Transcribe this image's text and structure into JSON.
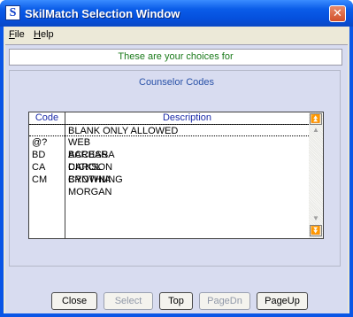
{
  "window": {
    "title": "SkilMatch Selection Window",
    "app_icon_glyph": "S",
    "close_glyph": "✕"
  },
  "menu": [
    {
      "label": "File",
      "underline": "F",
      "rest": "ile"
    },
    {
      "label": "Help",
      "underline": "H",
      "rest": "elp"
    }
  ],
  "banner": "These are your choices for",
  "subtitle": "Counselor Codes",
  "table": {
    "columns": [
      "Code",
      "Description"
    ],
    "rows": [
      {
        "code": "",
        "description": "BLANK ONLY ALLOWED",
        "selected": true
      },
      {
        "code": "@?",
        "description": "WEB ACCESS",
        "selected": false
      },
      {
        "code": "BD",
        "description": "BARBARA DICKSON",
        "selected": false
      },
      {
        "code": "CA",
        "description": "CAROL BROWNING",
        "selected": false
      },
      {
        "code": "CM",
        "description": "CYNTHIA MORGAN",
        "selected": false
      }
    ],
    "scroll_top_glyph": "⏫",
    "scroll_up_glyph": "▲",
    "scroll_down_glyph": "▼",
    "scroll_bottom_glyph": "⏬"
  },
  "buttons": [
    {
      "label": "Close",
      "enabled": true
    },
    {
      "label": "Select",
      "enabled": false
    },
    {
      "label": "Top",
      "enabled": true
    },
    {
      "label": "PageDn",
      "enabled": false
    },
    {
      "label": "PageUp",
      "enabled": true
    }
  ],
  "colors": {
    "titlebar": "#0a5ce8",
    "panel": "#d8dcf0",
    "banner_text": "#1a7a1a",
    "header_text": "#1a2aa8"
  }
}
